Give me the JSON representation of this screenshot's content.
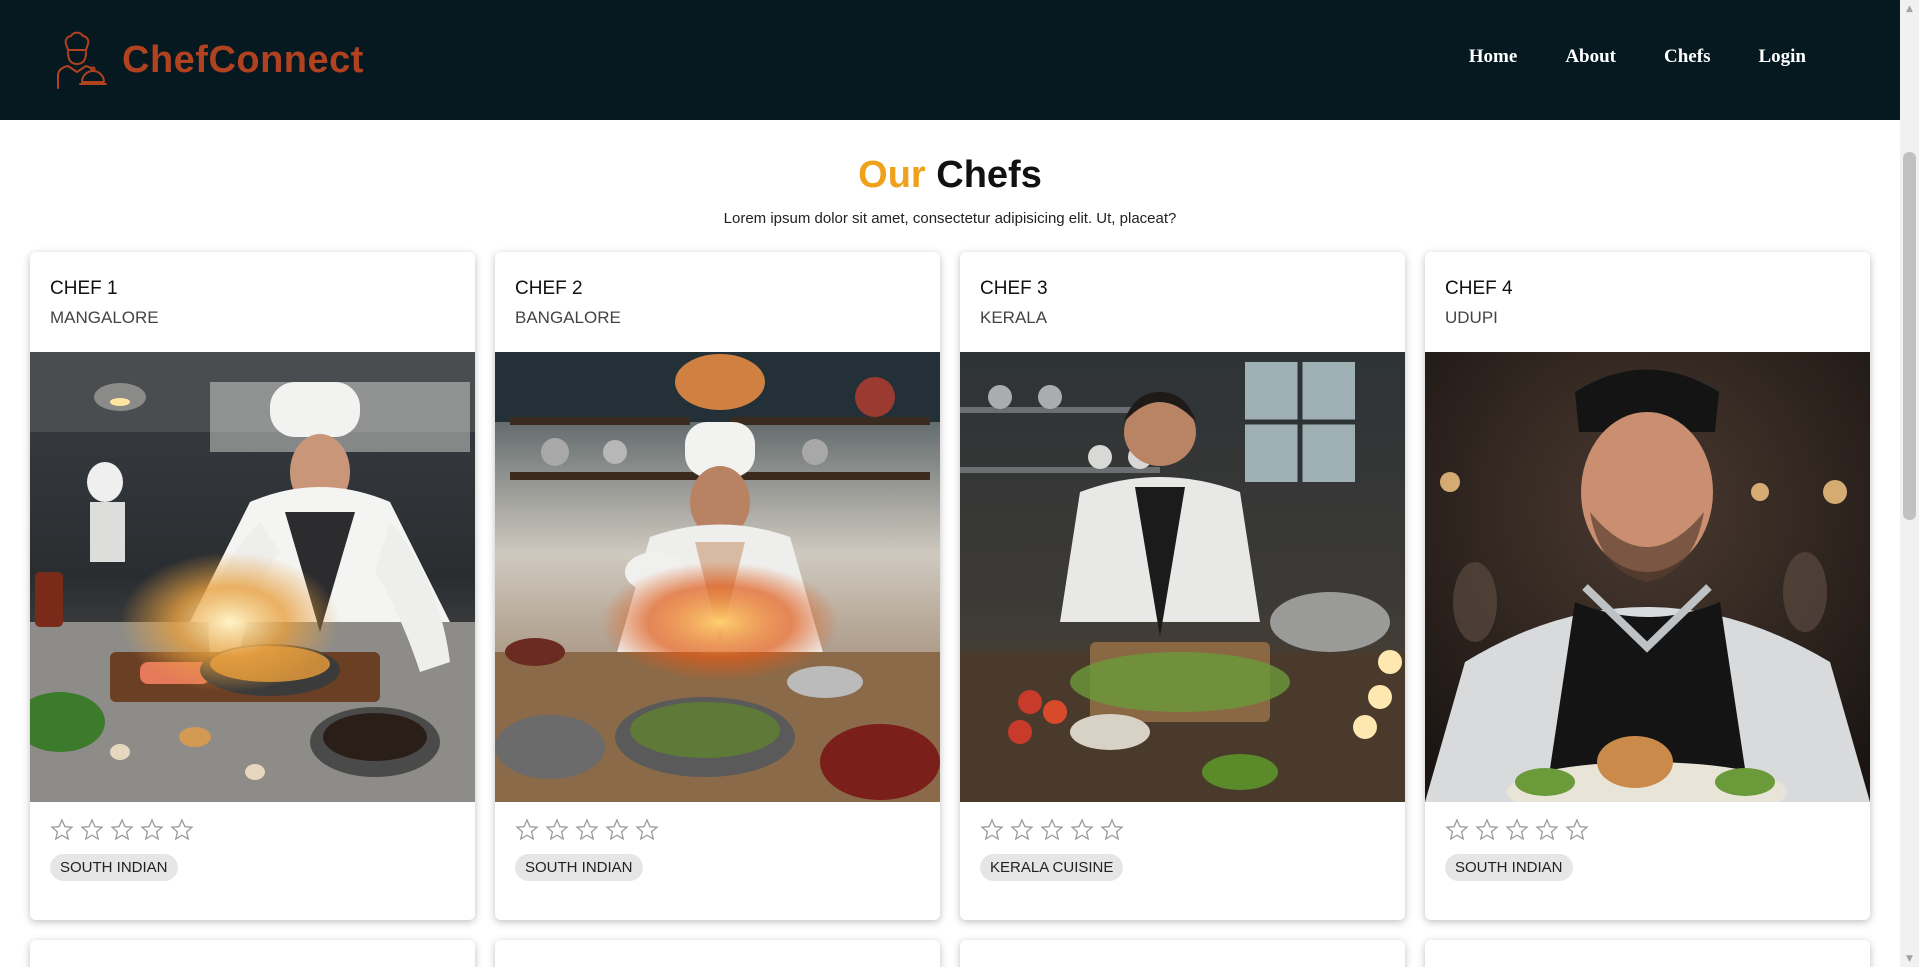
{
  "brand": {
    "name": "ChefConnect",
    "color": "#b04220",
    "icon": "chef-serving-cloche-icon"
  },
  "nav": {
    "items": [
      "Home",
      "About",
      "Chefs",
      "Login"
    ]
  },
  "section": {
    "title_accent": "Our",
    "title_main": "Chefs",
    "subtitle": "Lorem ipsum dolor sit amet, consectetur adipisicing elit. Ut, placeat?",
    "accent_color": "#f0a11a"
  },
  "chefs": [
    {
      "name": "CHEF 1",
      "city": "MANGALORE",
      "rating": 0,
      "tag": "SOUTH INDIAN",
      "photo": "chef-cooking-sizzling-pan-photo"
    },
    {
      "name": "CHEF 2",
      "city": "BANGALORE",
      "rating": 0,
      "tag": "SOUTH INDIAN",
      "photo": "chef-tossing-wok-flames-photo"
    },
    {
      "name": "CHEF 3",
      "city": "KERALA",
      "rating": 0,
      "tag": "KERALA CUISINE",
      "photo": "chef-chopping-vegetables-photo"
    },
    {
      "name": "CHEF 4",
      "city": "UDUPI",
      "rating": 0,
      "tag": "SOUTH INDIAN",
      "photo": "chef-portrait-black-apron-photo"
    }
  ],
  "colors": {
    "header_bg": "#061820",
    "tag_bg": "#e6e6e6",
    "star_outline": "#9a9a9a"
  }
}
